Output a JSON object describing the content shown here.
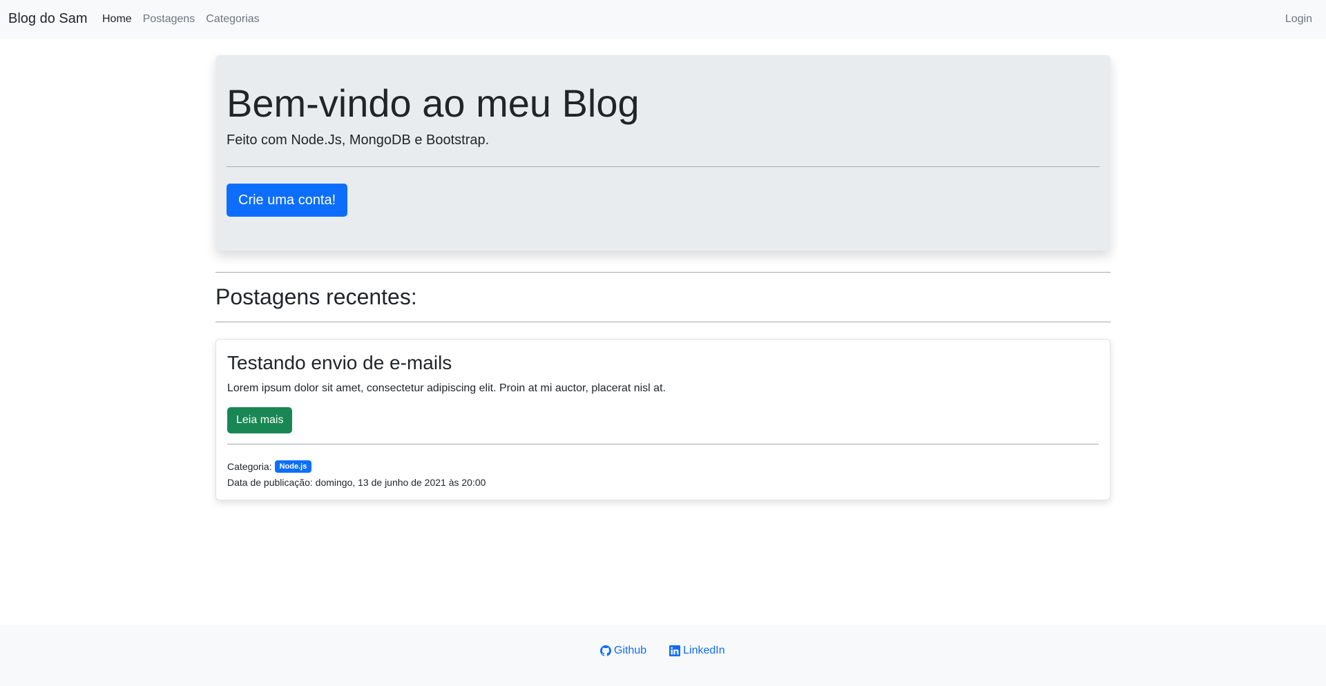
{
  "navbar": {
    "brand": "Blog do Sam",
    "links": [
      "Home",
      "Postagens",
      "Categorias"
    ],
    "login": "Login"
  },
  "hero": {
    "title": "Bem-vindo ao meu Blog",
    "lead": "Feito com Node.Js, MongoDB e Bootstrap.",
    "cta": "Crie uma conta!"
  },
  "recent": {
    "heading": "Postagens recentes:",
    "posts": [
      {
        "title": "Testando envio de e-mails",
        "excerpt": "Lorem ipsum dolor sit amet, consectetur adipiscing elit. Proin at mi auctor, placerat nisl at.",
        "read_more": "Leia mais",
        "category_label": "Categoria:",
        "category": "Node.js",
        "date_label": "Data de publicação:",
        "date": "domingo, 13 de junho de 2021 às 20:00"
      }
    ]
  },
  "footer": {
    "links": [
      {
        "label": "Github",
        "icon": "github-icon"
      },
      {
        "label": "LinkedIn",
        "icon": "linkedin-icon"
      }
    ]
  },
  "colors": {
    "primary": "#0d6efd",
    "success": "#198754",
    "navbar_bg": "#f8f9fa",
    "hero_bg": "#e9ecef"
  }
}
